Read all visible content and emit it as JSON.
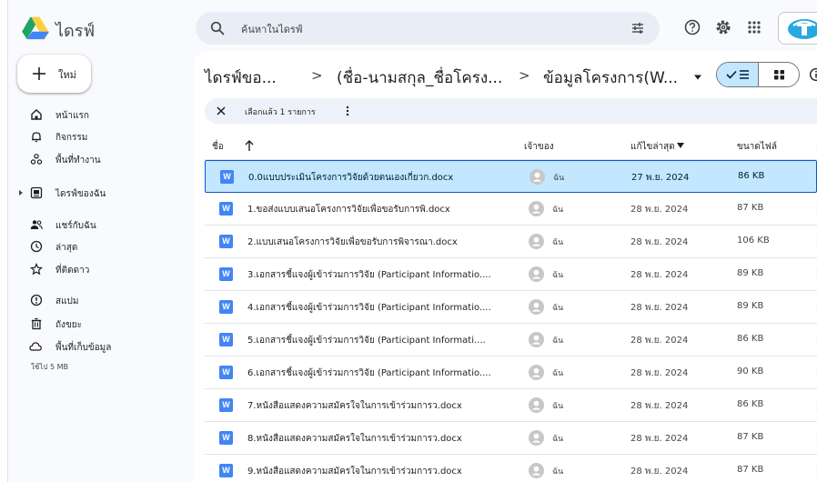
{
  "header": {
    "app_title": "ไดรฟ์",
    "search_placeholder": "ค้นหาในไดรฟ์",
    "icons": [
      "drive-logo",
      "search-icon",
      "tune-icon",
      "help-icon",
      "settings-icon",
      "apps-grid-icon",
      "account-badge"
    ]
  },
  "sidebar": {
    "new_label": "ใหม่",
    "items": [
      {
        "label": "หน้าแรก",
        "icon": "home-icon"
      },
      {
        "label": "กิจกรรม",
        "icon": "bell-icon"
      },
      {
        "label": "พื้นที่ทำงาน",
        "icon": "workspaces-icon"
      },
      {
        "label": "ไดรฟ์ของฉัน",
        "icon": "my-drive-icon"
      },
      {
        "label": "แชร์กับฉัน",
        "icon": "shared-icon"
      },
      {
        "label": "ล่าสุด",
        "icon": "clock-icon"
      },
      {
        "label": "ที่ติดดาว",
        "icon": "star-icon"
      },
      {
        "label": "สแปม",
        "icon": "spam-icon"
      },
      {
        "label": "ถังขยะ",
        "icon": "trash-icon"
      },
      {
        "label": "พื้นที่เก็บข้อมูล",
        "icon": "cloud-icon"
      }
    ],
    "storage_used": "ใช้ไป 5 MB"
  },
  "breadcrumb": {
    "items": [
      "ไดรฟ์ขอ...",
      "(ชื่อ-นามสกุล_ชื่อโครง...",
      "ข้อมูลโครงการ(W..."
    ],
    "separator": ">"
  },
  "selection_bar": {
    "text": "เลือกแล้ว 1 รายการ"
  },
  "table": {
    "columns": {
      "name": "ชื่อ",
      "owner": "เจ้าของ",
      "modified": "แก้ไขล่าสุด",
      "size": "ขนาดไฟล์"
    },
    "rows": [
      {
        "name": "0.0แบบประเมินโครงการวิจัยด้วยตนเองเกี่ยวก.docx",
        "owner": "ฉัน",
        "modified": "27 พ.ย. 2024",
        "size": "86 KB",
        "selected": true
      },
      {
        "name": "1.ขอส่งแบบเสนอโครงการวิจัยเพื่อขอรับการพิ.docx",
        "owner": "ฉัน",
        "modified": "28 พ.ย. 2024",
        "size": "87 KB",
        "selected": false
      },
      {
        "name": "2.แบบเสนอโครงการวิจัยเพื่อขอรับการพิจารณา.docx",
        "owner": "ฉัน",
        "modified": "28 พ.ย. 2024",
        "size": "106 KB",
        "selected": false
      },
      {
        "name": "3.เอกสารชี้แจงผู้เข้าร่วมการวิจัย (Participant Informatio....",
        "owner": "ฉัน",
        "modified": "28 พ.ย. 2024",
        "size": "89 KB",
        "selected": false
      },
      {
        "name": "4.เอกสารชี้แจงผู้เข้าร่วมการวิจัย (Participant Informatio....",
        "owner": "ฉัน",
        "modified": "28 พ.ย. 2024",
        "size": "89 KB",
        "selected": false
      },
      {
        "name": "5.เอกสารชี้แจงผู้เข้าร่วมการวิจัย  (Participant Informati....",
        "owner": "ฉัน",
        "modified": "28 พ.ย. 2024",
        "size": "86 KB",
        "selected": false
      },
      {
        "name": "6.เอกสารชี้แจงผู้เข้าร่วมการวิจัย (Participant Informatio....",
        "owner": "ฉัน",
        "modified": "28 พ.ย. 2024",
        "size": "90 KB",
        "selected": false
      },
      {
        "name": "7.หนังสือแสดงความสมัครใจในการเข้าร่วมการว.docx",
        "owner": "ฉัน",
        "modified": "28 พ.ย. 2024",
        "size": "86 KB",
        "selected": false
      },
      {
        "name": "8.หนังสือแสดงความสมัครใจในการเข้าร่วมการว.docx",
        "owner": "ฉัน",
        "modified": "28 พ.ย. 2024",
        "size": "87 KB",
        "selected": false
      },
      {
        "name": "9.หนังสือแสดงความสมัครใจในการเข้าร่วมการว.docx",
        "owner": "ฉัน",
        "modified": "28 พ.ย. 2024",
        "size": "87 KB",
        "selected": false
      }
    ],
    "file_icon_letter": "W"
  },
  "colors": {
    "accent": "#0b57d0",
    "selected_row": "#c2e7ff",
    "search_bg": "#e9eef6",
    "word_icon": "#4285f4"
  }
}
